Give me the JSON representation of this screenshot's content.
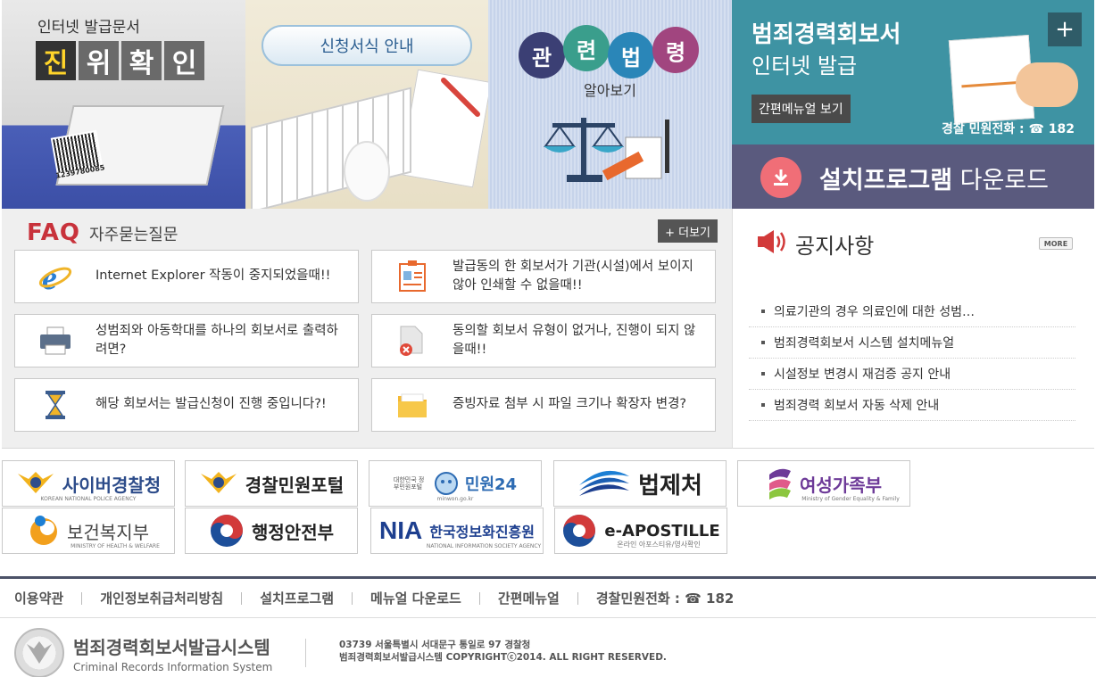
{
  "banners": {
    "verify": {
      "small": "인터넷 발급문서",
      "chars": [
        "진",
        "위",
        "확",
        "인"
      ],
      "barcode_text": "1239780085"
    },
    "forms": {
      "label": "신청서식 안내"
    },
    "laws": {
      "chars": [
        "관",
        "련",
        "법",
        "령"
      ],
      "sub": "알아보기"
    },
    "internet": {
      "title": "범죄경력회보서",
      "subtitle": "인터넷 발급",
      "plus": "+",
      "guide_label": "간편메뉴얼 보기",
      "phone": "경찰 민원전화 : ☎ 182"
    },
    "download": {
      "bold": "설치프로그램",
      "rest": " 다운로드"
    }
  },
  "faq": {
    "title_en": "FAQ",
    "title_ko": "자주묻는질문",
    "more_label": "+ 더보기",
    "items": [
      {
        "icon": "internet-explorer-icon",
        "text": "Internet Explorer 작동이 중지되었을때!!"
      },
      {
        "icon": "id-document-icon",
        "text": "발급동의 한 회보서가 기관(시설)에서 보이지 않아 인쇄할 수 없을때!!"
      },
      {
        "icon": "printer-icon",
        "text": "성범죄와 아동학대를 하나의 회보서로 출력하려면?"
      },
      {
        "icon": "document-error-icon",
        "text": "동의할 회보서 유형이 없거나, 진행이 되지 않을때!!"
      },
      {
        "icon": "hourglass-icon",
        "text": "해당 회보서는 발급신청이 진행 중입니다?!"
      },
      {
        "icon": "folder-icon",
        "text": "증빙자료 첨부 시 파일 크기나 확장자 변경?"
      }
    ]
  },
  "notice": {
    "title": "공지사항",
    "more_label": "MORE",
    "items": [
      "의료기관의 경우 의료인에 대한 성범…",
      "범죄경력회보서 시스템 설치메뉴얼",
      "시설정보 변경시 재검증 공지 안내",
      "범죄경력 회보서 자동 삭제 안내"
    ]
  },
  "logos": [
    {
      "name": "사이버경찰청",
      "sub": "KOREAN NATIONAL POLICE AGENCY"
    },
    {
      "name": "경찰민원포털",
      "sub": ""
    },
    {
      "name": "민원24",
      "sub": "minwon.go.kr",
      "pre": "대한민국 정부민원포털"
    },
    {
      "name": "법제처",
      "sub": ""
    },
    {
      "name": "여성가족부",
      "sub": "Ministry of Gender Equality & Family"
    },
    {
      "name": "보건복지부",
      "sub": "MINISTRY OF HEALTH & WELFARE"
    },
    {
      "name": "행정안전부",
      "sub": ""
    },
    {
      "name": "한국정보화진흥원",
      "sub": "NATIONAL INFORMATION SOCIETY AGENCY",
      "pre": "NIA"
    },
    {
      "name": "e-APOSTILLE",
      "sub": "온라인 아포스티유/영사확인"
    }
  ],
  "footer": {
    "links": [
      "이용약관",
      "개인정보취급처리방침",
      "설치프로그램",
      "메뉴얼 다운로드",
      "간편메뉴얼",
      "경찰민원전화 : ☎ 182"
    ],
    "brand_ko": "범죄경력회보서발급시스템",
    "brand_en": "Criminal Records Information System",
    "address": "03739   서울특별시 서대문구 통일로 97 경찰청",
    "copyright": "범죄경력회보서발급시스템 COPYRIGHTⓒ2014. ALL RIGHT RESERVED."
  },
  "colors": {
    "accent_red": "#c8323b",
    "teal": "#3e93a3",
    "purple": "#5a5a7e",
    "download_icon": "#f06e77"
  }
}
